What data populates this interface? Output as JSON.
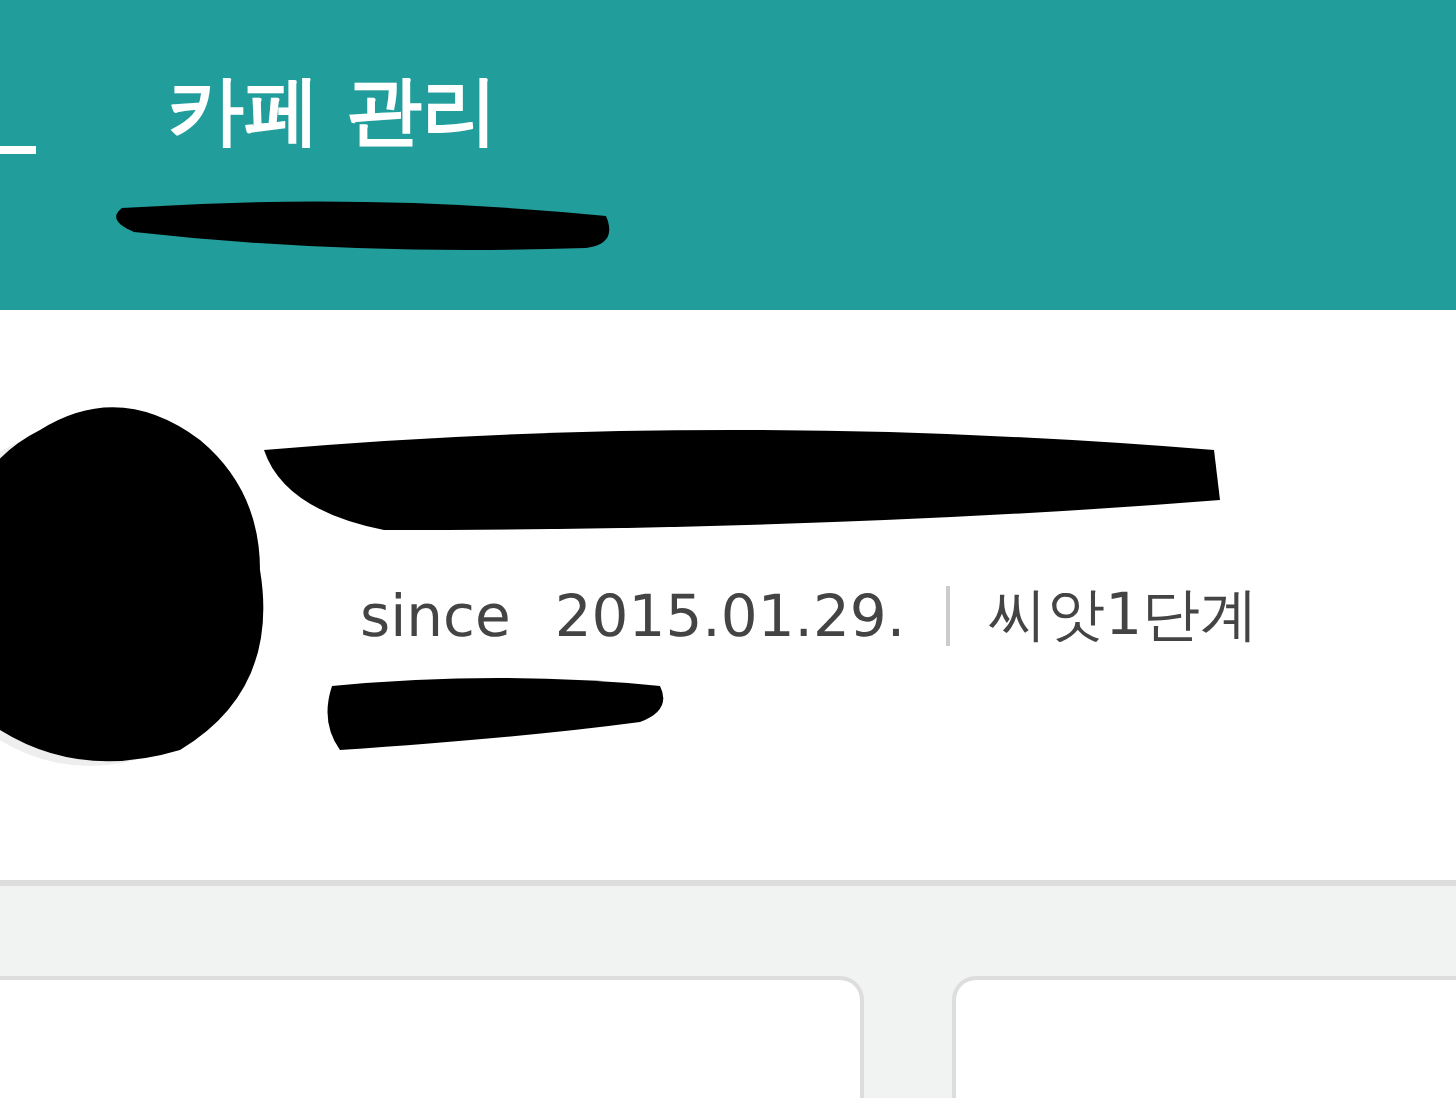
{
  "header": {
    "title": "카페 관리"
  },
  "profile": {
    "since_label": "since",
    "date": "2015.01.29.",
    "level": "씨앗1단계"
  }
}
